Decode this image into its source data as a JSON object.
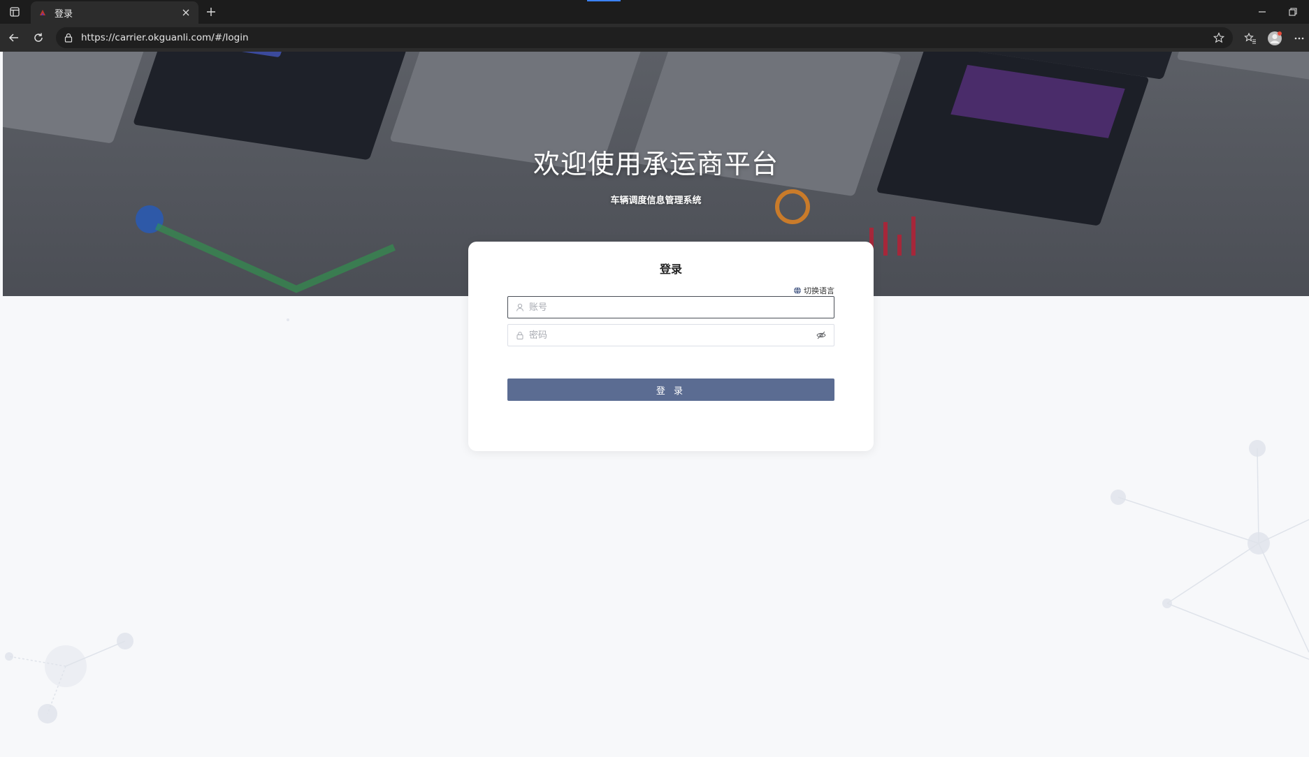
{
  "browser": {
    "tab_title": "登录",
    "url": "https://carrier.okguanli.com/#/login"
  },
  "hero": {
    "title": "欢迎使用承运商平台",
    "subtitle": "车辆调度信息管理系统"
  },
  "login": {
    "title": "登录",
    "language_switch": "切换语言",
    "account_placeholder": "账号",
    "password_placeholder": "密码",
    "submit_label": "登 录"
  },
  "colors": {
    "primary_button": "#5b6c92",
    "hero_overlay": "#4b4e55",
    "page_background": "#f7f8fa"
  }
}
